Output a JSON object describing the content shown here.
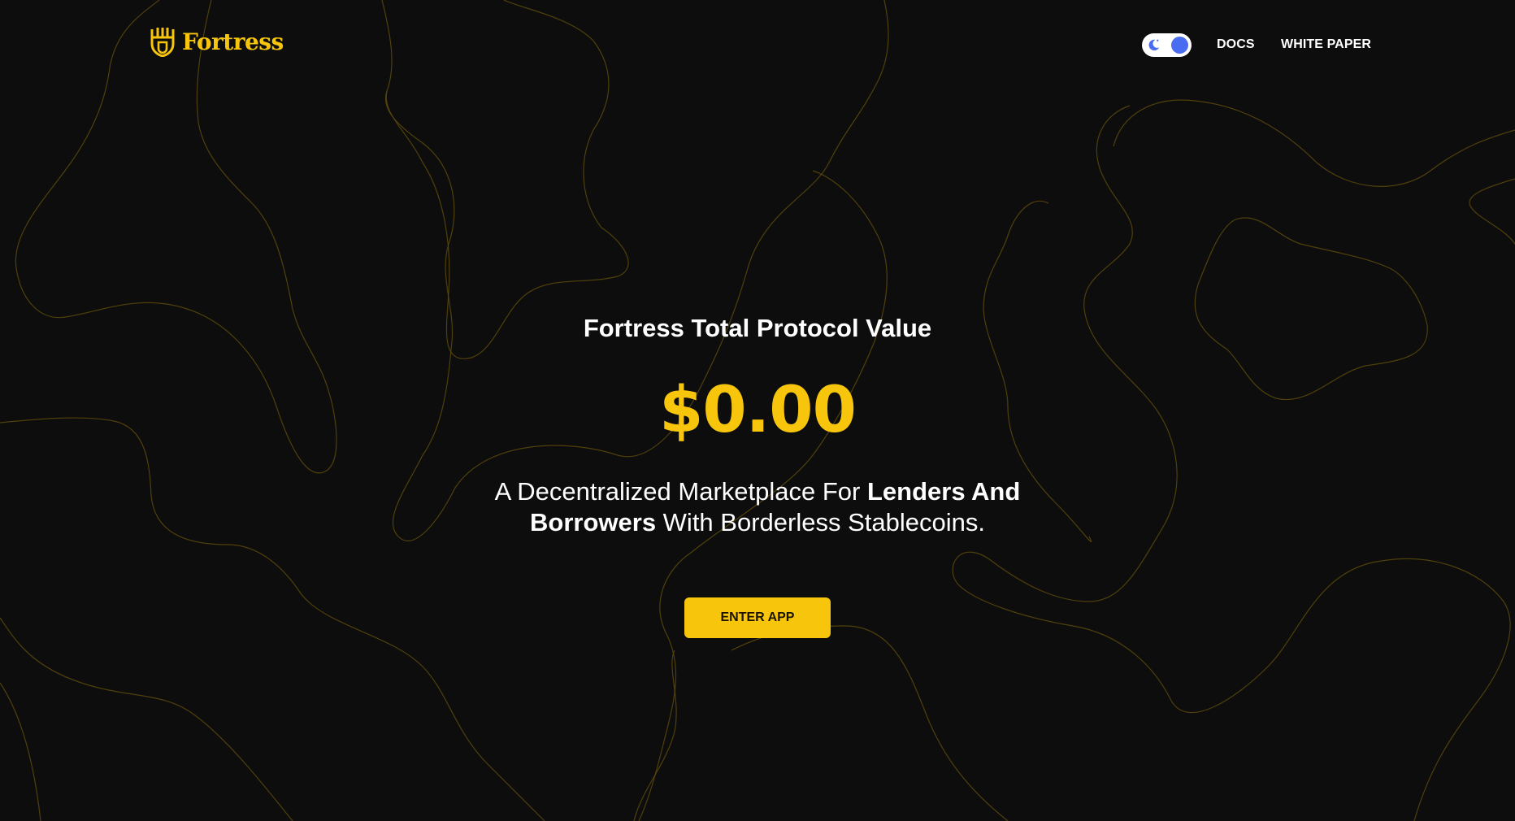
{
  "brand": {
    "name": "Fortress",
    "accent_color": "#f7c50b",
    "logo_icon": "shield-crown-icon"
  },
  "theme_toggle": {
    "icon": "moon-icon",
    "state": "on",
    "knob_color": "#4a6cf0"
  },
  "nav": {
    "docs": "DOCS",
    "white_paper": "WHITE PAPER"
  },
  "hero": {
    "title": "Fortress Total Protocol Value",
    "value": "$0.00",
    "desc_part1": "A Decentralized Marketplace For ",
    "desc_bold": "Lenders And Borrowers",
    "desc_part2": " With Borderless Stablecoins.",
    "cta": "ENTER APP"
  },
  "colors": {
    "background": "#0d0d0d",
    "topo_lines": "#5c4a0c",
    "text": "#ffffff"
  }
}
